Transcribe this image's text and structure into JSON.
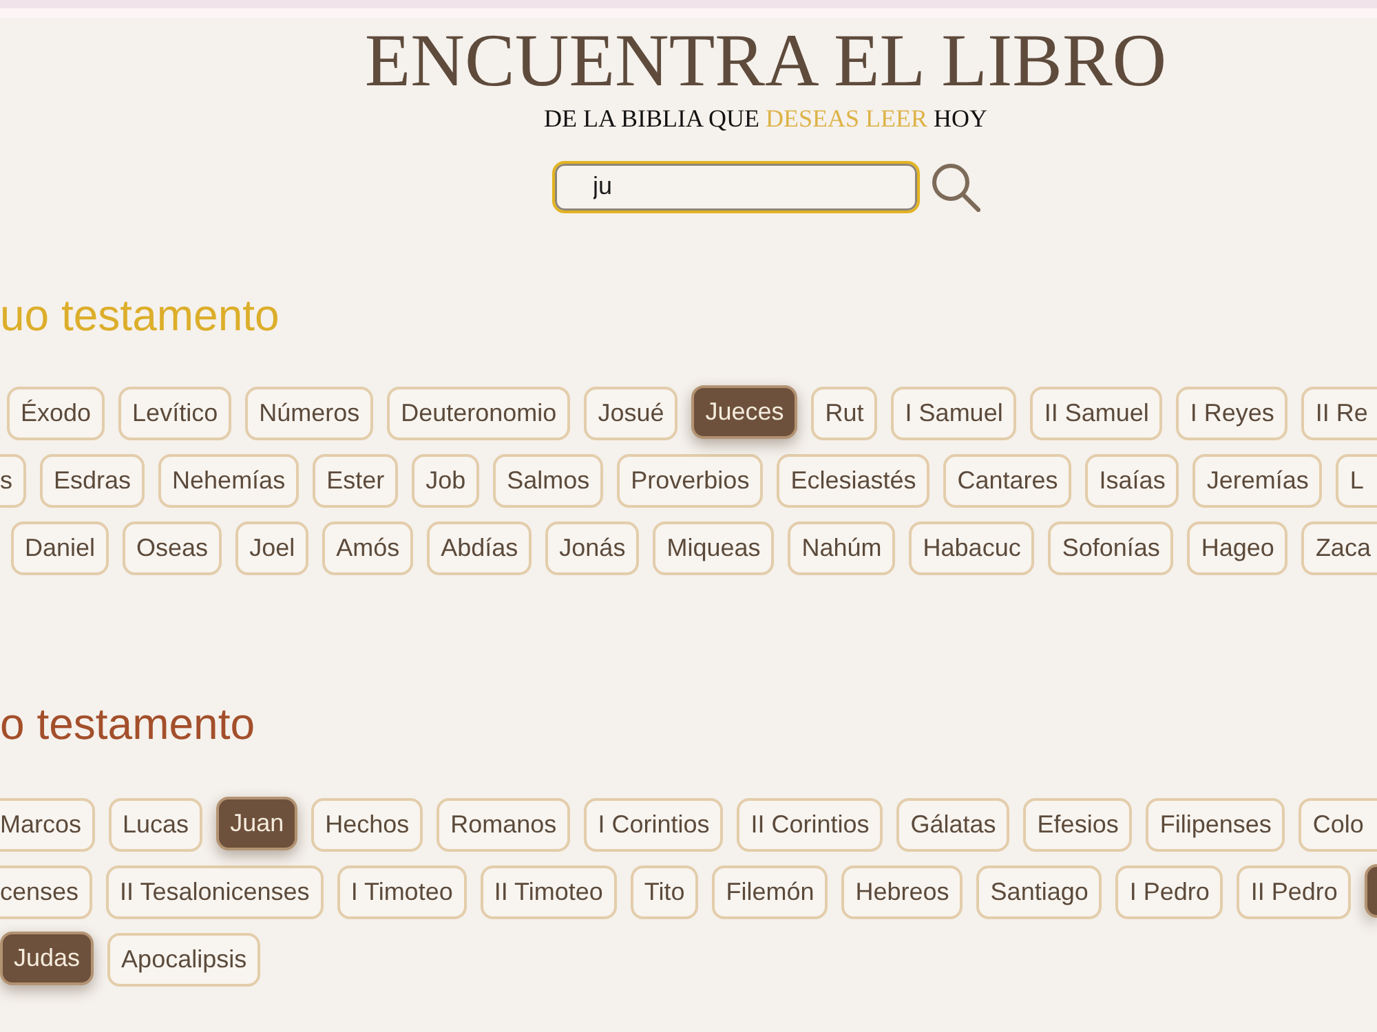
{
  "header": {
    "title": "ENCUENTRA EL LIBRO",
    "subtitle": [
      {
        "text": "DE LA BIBLIA QUE",
        "highlight": false
      },
      {
        "text": "DESEAS LEER",
        "highlight": true
      },
      {
        "text": "HOY",
        "highlight": false
      }
    ]
  },
  "search": {
    "value": "ju"
  },
  "sections": [
    {
      "heading": "uo testamento",
      "color": "#dcae2a",
      "rows": [
        {
          "books": [
            {
              "label": "Éxodo",
              "selected": false
            },
            {
              "label": "Levítico",
              "selected": false
            },
            {
              "label": "Números",
              "selected": false
            },
            {
              "label": "Deuteronomio",
              "selected": false
            },
            {
              "label": "Josué",
              "selected": false
            },
            {
              "label": "Jueces",
              "selected": true
            },
            {
              "label": "Rut",
              "selected": false
            },
            {
              "label": "I Samuel",
              "selected": false
            },
            {
              "label": "II Samuel",
              "selected": false
            },
            {
              "label": "I Reyes",
              "selected": false
            }
          ],
          "trail": {
            "label": "II Re",
            "selected": false
          }
        },
        {
          "lead": {
            "label": "s",
            "selected": false
          },
          "books": [
            {
              "label": "Esdras",
              "selected": false
            },
            {
              "label": "Nehemías",
              "selected": false
            },
            {
              "label": "Ester",
              "selected": false
            },
            {
              "label": "Job",
              "selected": false
            },
            {
              "label": "Salmos",
              "selected": false
            },
            {
              "label": "Proverbios",
              "selected": false
            },
            {
              "label": "Eclesiastés",
              "selected": false
            },
            {
              "label": "Cantares",
              "selected": false
            },
            {
              "label": "Isaías",
              "selected": false
            },
            {
              "label": "Jeremías",
              "selected": false
            }
          ],
          "trail": {
            "label": "L",
            "selected": false
          }
        },
        {
          "books": [
            {
              "label": "Daniel",
              "selected": false
            },
            {
              "label": "Oseas",
              "selected": false
            },
            {
              "label": "Joel",
              "selected": false
            },
            {
              "label": "Amós",
              "selected": false
            },
            {
              "label": "Abdías",
              "selected": false
            },
            {
              "label": "Jonás",
              "selected": false
            },
            {
              "label": "Miqueas",
              "selected": false
            },
            {
              "label": "Nahúm",
              "selected": false
            },
            {
              "label": "Habacuc",
              "selected": false
            },
            {
              "label": "Sofonías",
              "selected": false
            },
            {
              "label": "Hageo",
              "selected": false
            }
          ],
          "trail": {
            "label": "Zaca",
            "selected": false
          }
        }
      ]
    },
    {
      "heading": "o testamento",
      "color": "#a34f2b",
      "rows": [
        {
          "lead": {
            "label": "Marcos",
            "selected": false
          },
          "books": [
            {
              "label": "Lucas",
              "selected": false
            },
            {
              "label": "Juan",
              "selected": true
            },
            {
              "label": "Hechos",
              "selected": false
            },
            {
              "label": "Romanos",
              "selected": false
            },
            {
              "label": "I Corintios",
              "selected": false
            },
            {
              "label": "II Corintios",
              "selected": false
            },
            {
              "label": "Gálatas",
              "selected": false
            },
            {
              "label": "Efesios",
              "selected": false
            },
            {
              "label": "Filipenses",
              "selected": false
            }
          ],
          "trail": {
            "label": "Colo",
            "selected": false
          }
        },
        {
          "lead": {
            "label": "censes",
            "selected": false
          },
          "books": [
            {
              "label": "II Tesalonicenses",
              "selected": false
            },
            {
              "label": "I Timoteo",
              "selected": false
            },
            {
              "label": "II Timoteo",
              "selected": false
            },
            {
              "label": "Tito",
              "selected": false
            },
            {
              "label": "Filemón",
              "selected": false
            },
            {
              "label": "Hebreos",
              "selected": false
            },
            {
              "label": "Santiago",
              "selected": false
            },
            {
              "label": "I Pedro",
              "selected": false
            },
            {
              "label": "II Pedro",
              "selected": false
            }
          ],
          "trail": {
            "selected": true
          }
        },
        {
          "books": [
            {
              "label": "Judas",
              "selected": true
            },
            {
              "label": "Apocalipsis",
              "selected": false
            }
          ]
        }
      ]
    }
  ]
}
